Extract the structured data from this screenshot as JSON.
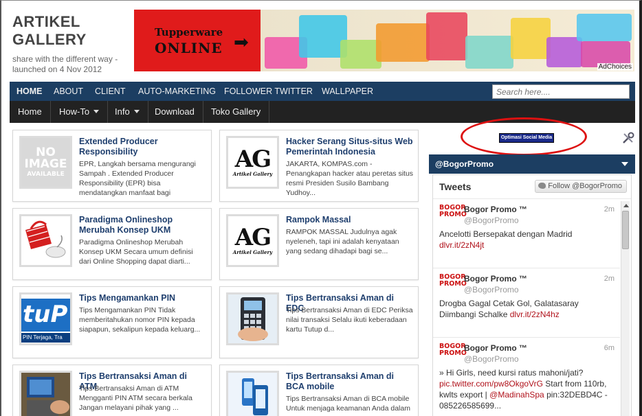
{
  "header": {
    "title_line1": "ARTIKEL",
    "title_line2": "GALLERY",
    "description": "share with the different way - launched on 4 Nov 2012"
  },
  "banner": {
    "brand": "Tupperware",
    "subtitle": "ONLINE",
    "arrow": "➡",
    "adchoices": "AdChoices"
  },
  "top_nav": {
    "items": [
      "HOME",
      "ABOUT",
      "CLIENT",
      "AUTO-MARKETING",
      "FOLLOWER TWITTER",
      "WALLPAPER"
    ],
    "search_placeholder": "Search here...."
  },
  "sub_nav": {
    "items": [
      "Home",
      "How-To",
      "Info",
      "Download",
      "Toko Gallery"
    ]
  },
  "posts": [
    {
      "title": "Extended Producer Responsibility",
      "snippet": "EPR, Langkah bersama mengurangi Sampah . Extended Producer Responsibility  (EPR) bisa mendatangkan manfaat bagi",
      "thumb": "no-image",
      "thumb_text": [
        "NO",
        "IMAGE",
        "AVAILABLE"
      ]
    },
    {
      "title": "Hacker Serang Situs-situs Web Pemerintah Indonesia",
      "snippet": "JAKARTA, KOMPAS.com  - Penangkapan hacker atau peretas situs resmi Presiden Susilo Bambang Yudhoy...",
      "thumb": "ag-logo",
      "thumb_text": [
        "AG",
        "Artikel Gallery"
      ]
    },
    {
      "title": "Paradigma Onlineshop Merubah Konsep UKM",
      "snippet": "Paradigma Onlineshop Merubah Konsep UKM Secara umum definisi dari Online Shopping dapat diarti...",
      "thumb": "shopping-basket"
    },
    {
      "title": "Rampok Massal",
      "snippet": "RAMPOK MASSAL Judulnya agak nyeleneh, tapi ini adalah kenyataan yang sedang dihadapi bagi se...",
      "thumb": "ag-logo",
      "thumb_text": [
        "AG",
        "Artikel Gallery"
      ]
    },
    {
      "title": "Tips Mengamankan PIN",
      "snippet": "Tips Mengamankan PIN Tidak memberitahukan nomor PIN kepada siapapun, sekalipun kepada keluarg...",
      "thumb": "pin-card",
      "thumb_text": [
        "tuP",
        "PIN Terjaga, Tra"
      ]
    },
    {
      "title": "Tips Bertransaksi Aman di EDC",
      "snippet": "Tips Bertransaksi Aman di EDC Periksa nilai transaksi Selalu ikuti keberadaan kartu Tutup d...",
      "thumb": "edc-machine"
    },
    {
      "title": "Tips Bertransaksi Aman di ATM",
      "snippet": "Tips Bertransaksi Aman di ATM Mengganti  PIN ATM secara berkala Jangan  melayani pihak yang ...",
      "thumb": "atm-photo"
    },
    {
      "title": "Tips Bertransaksi Aman di BCA mobile",
      "snippet": "Tips Bertransaksi Aman di BCA mobile Untuk menjaga keamanan Anda dalam",
      "thumb": "bca-mobile"
    }
  ],
  "sidebar": {
    "optimasi_badge": "Optimasi Social Media",
    "widget_title": "@BogorPromo",
    "tweets_title": "Tweets",
    "follow_button": "Follow @BogorPromo",
    "avatar_text": [
      "BOGOR",
      "PROMO"
    ],
    "tweets": [
      {
        "name": "Bogor Promo ™",
        "handle": "@BogorPromo",
        "time": "2m",
        "text": "Ancelotti Bersepakat dengan Madrid",
        "link": "dlvr.it/2zN4jt"
      },
      {
        "name": "Bogor Promo ™",
        "handle": "@BogorPromo",
        "time": "2m",
        "text": "Drogba Gagal Cetak Gol, Galatasaray Diimbangi Schalke",
        "link": "dlvr.it/2zN4hz"
      },
      {
        "name": "Bogor Promo ™",
        "handle": "@BogorPromo",
        "time": "6m",
        "text_before": "» Hi Girls, need kursi ratus mahoni/jati?",
        "link": "pic.twitter.com/pw8OkgoVrG",
        "text_mid": "Start from 110rb, kwlts export |",
        "link2": "@MadinahSpa",
        "text_after": "pin:32DEBD4C - 085226585699..."
      }
    ]
  },
  "colors": {
    "nav_blue": "#1c3e62",
    "subnav_black": "#222222",
    "link_blue": "#1f3f6e",
    "tweet_link_red": "#b0111a",
    "banner_red": "#e01b1b",
    "highlight_ellipse": "#dd1111"
  }
}
